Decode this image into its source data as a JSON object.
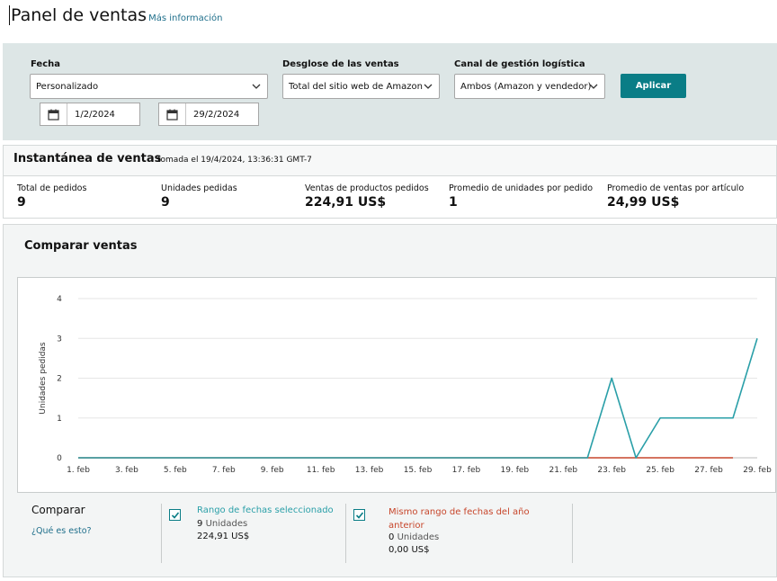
{
  "header": {
    "title": "Panel de ventas",
    "more_info": "Más información"
  },
  "filters": {
    "date_label": "Fecha",
    "date_select": "Personalizado",
    "start_date": "1/2/2024",
    "end_date": "29/2/2024",
    "breakdown_label": "Desglose de las ventas",
    "breakdown_select": "Total del sitio web de Amazon",
    "channel_label": "Canal de gestión logística",
    "channel_select": "Ambos (Amazon y vendedor)",
    "apply": "Aplicar"
  },
  "snapshot": {
    "title": "Instantánea de ventas",
    "taken": "tomada el 19/4/2024, 13:36:31 GMT-7",
    "metrics": [
      {
        "label": "Total de pedidos",
        "value": "9"
      },
      {
        "label": "Unidades pedidas",
        "value": "9"
      },
      {
        "label": "Ventas de productos pedidos",
        "value": "224,91 US$"
      },
      {
        "label": "Promedio de unidades por pedido",
        "value": "1"
      },
      {
        "label": "Promedio de ventas por artículo",
        "value": "24,99 US$"
      }
    ]
  },
  "compare": {
    "title": "Comparar ventas",
    "label": "Comparar",
    "what_link": "¿Qué es esto?",
    "legend": [
      {
        "title": "Rango de fechas seleccionado",
        "units_count": "9",
        "units_word": "Unidades",
        "amount": "224,91 US$",
        "color": "#2a9fa8"
      },
      {
        "title": "Mismo rango de fechas del año anterior",
        "units_count": "0",
        "units_word": "Unidades",
        "amount": "0,00 US$",
        "color": "#c7462b"
      }
    ]
  },
  "chart_data": {
    "type": "line",
    "ylabel": "Unidades pedidas",
    "ylim": [
      0,
      4
    ],
    "yticks": [
      0,
      1,
      2,
      3,
      4
    ],
    "grid": true,
    "xtick_labels": [
      "1. feb",
      "3. feb",
      "5. feb",
      "7. feb",
      "9. feb",
      "11. feb",
      "13. feb",
      "15. feb",
      "17. feb",
      "19. feb",
      "21. feb",
      "23. feb",
      "25. feb",
      "27. feb",
      "29. feb"
    ],
    "x": [
      1,
      2,
      3,
      4,
      5,
      6,
      7,
      8,
      9,
      10,
      11,
      12,
      13,
      14,
      15,
      16,
      17,
      18,
      19,
      20,
      21,
      22,
      23,
      24,
      25,
      26,
      27,
      28,
      29
    ],
    "series": [
      {
        "name": "Rango de fechas seleccionado",
        "color": "#2a9fa8",
        "values": [
          0,
          0,
          0,
          0,
          0,
          0,
          0,
          0,
          0,
          0,
          0,
          0,
          0,
          0,
          0,
          0,
          0,
          0,
          0,
          0,
          0,
          0,
          2,
          0,
          1,
          1,
          1,
          1,
          3
        ]
      },
      {
        "name": "Mismo rango de fechas del año anterior",
        "color": "#c7462b",
        "values": [
          0,
          0,
          0,
          0,
          0,
          0,
          0,
          0,
          0,
          0,
          0,
          0,
          0,
          0,
          0,
          0,
          0,
          0,
          0,
          0,
          0,
          0,
          0,
          0,
          0,
          0,
          0,
          0,
          null
        ]
      }
    ]
  }
}
